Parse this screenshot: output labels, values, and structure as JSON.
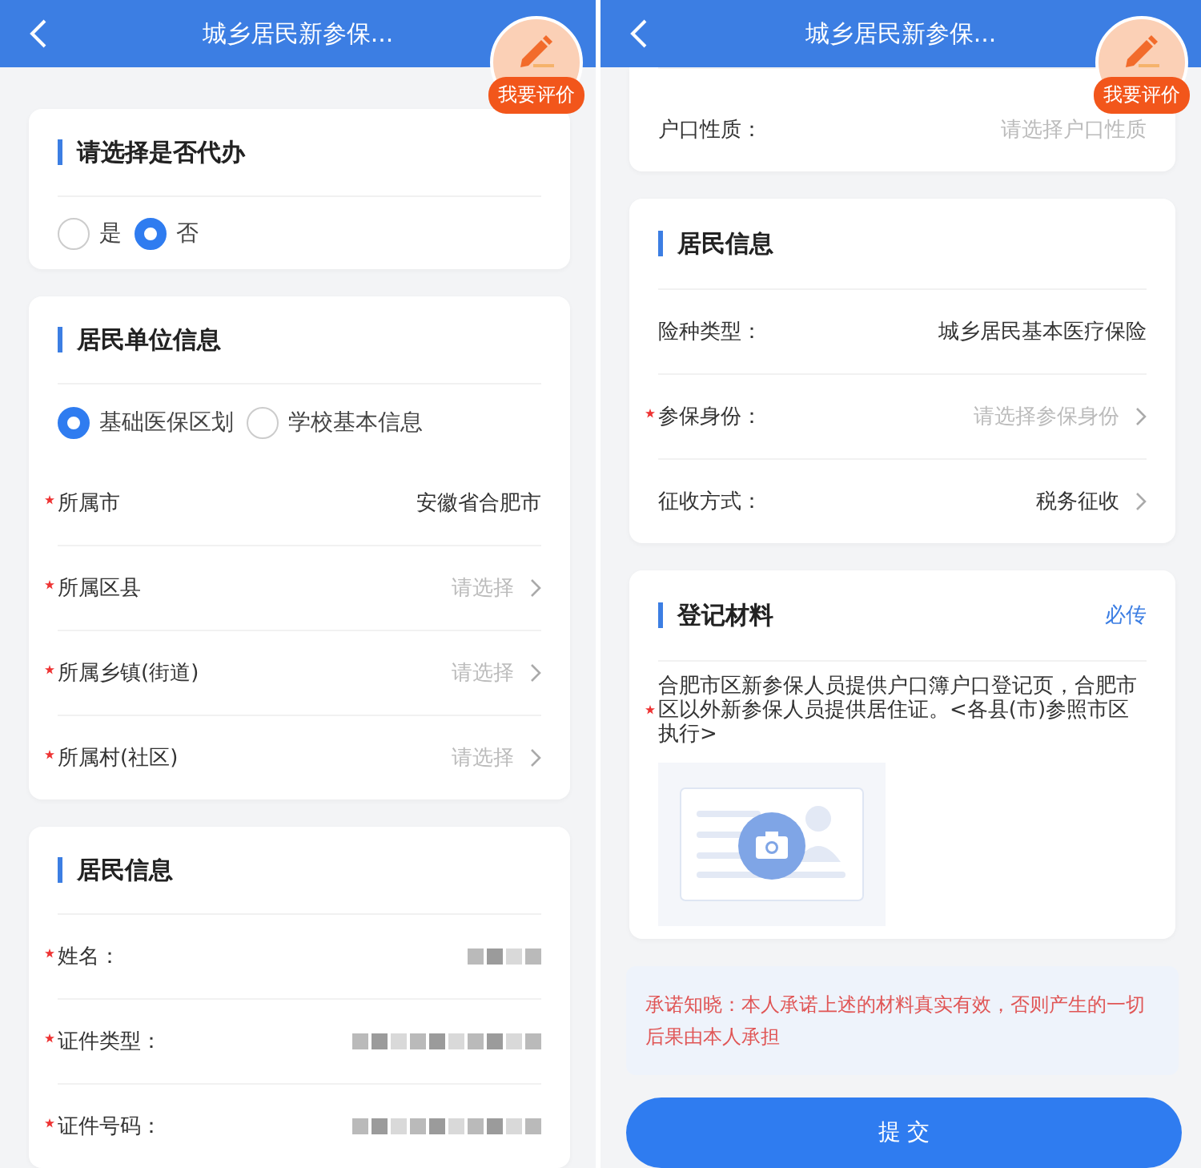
{
  "screens": [
    {
      "header": {
        "title": "城乡居民新参保..."
      },
      "badge": {
        "label": "我要评价"
      },
      "sections": [
        {
          "kind": "radios",
          "title": "请选择是否代办",
          "options": [
            {
              "label": "是",
              "selected": false
            },
            {
              "label": "否",
              "selected": true
            }
          ]
        },
        {
          "kind": "form",
          "title": "居民单位信息",
          "options": [
            {
              "label": "基础医保区划",
              "selected": true
            },
            {
              "label": "学校基本信息",
              "selected": false
            }
          ],
          "fields": [
            {
              "label": "所属市",
              "required": true,
              "value": "安徽省合肥市",
              "chevron": false
            },
            {
              "label": "所属区县",
              "required": true,
              "placeholder": "请选择",
              "chevron": true
            },
            {
              "label": "所属乡镇(街道)",
              "required": true,
              "placeholder": "请选择",
              "chevron": true
            },
            {
              "label": "所属村(社区)",
              "required": true,
              "placeholder": "请选择",
              "chevron": true
            }
          ]
        },
        {
          "kind": "form",
          "title": "居民信息",
          "fields": [
            {
              "label": "姓名：",
              "required": true,
              "redacted": true,
              "chevron": false
            },
            {
              "label": "证件类型：",
              "required": true,
              "redacted": true,
              "chevron": false
            },
            {
              "label": "证件号码：",
              "required": true,
              "redacted": true,
              "chevron": false
            }
          ]
        }
      ]
    },
    {
      "header": {
        "title": "城乡居民新参保..."
      },
      "badge": {
        "label": "我要评价"
      },
      "sections": [
        {
          "kind": "form",
          "fields": [
            {
              "label": "户口性质：",
              "required": false,
              "placeholder": "请选择户口性质",
              "chevron": false
            }
          ]
        },
        {
          "kind": "form",
          "title": "居民信息",
          "fields": [
            {
              "label": "险种类型：",
              "required": false,
              "value": "城乡居民基本医疗保险",
              "chevron": false
            },
            {
              "label": "参保身份：",
              "required": true,
              "placeholder": "请选择参保身份",
              "chevron": true
            },
            {
              "label": "征收方式：",
              "required": false,
              "value": "税务征收",
              "chevron": true
            }
          ]
        },
        {
          "kind": "upload",
          "title": "登记材料",
          "tag": "必传",
          "required": true,
          "text": "合肥市区新参保人员提供户口簿户口登记页，合肥市区以外新参保人员提供居住证。<各县(市)参照市区执行>"
        },
        {
          "kind": "notice",
          "text": "承诺知晓：本人承诺上述的材料真实有效，否则产生的一切后果由本人承担"
        },
        {
          "kind": "submit",
          "label": "提 交"
        }
      ]
    }
  ]
}
